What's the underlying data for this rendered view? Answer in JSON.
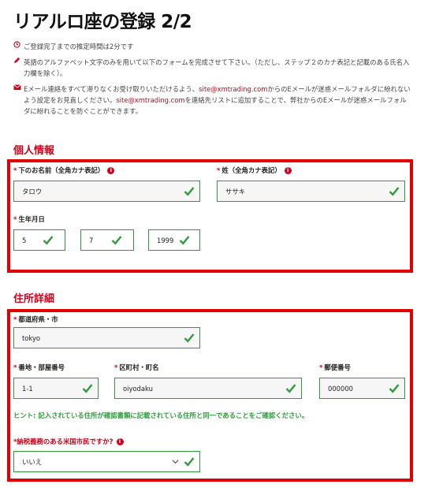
{
  "header": {
    "title": "リアルロ座の登録 2/2"
  },
  "notes": {
    "time": "ご登録完了までの推定時間は2分です",
    "alphabet": "英語のアルファベット文字のみを用いて以下のフォームを完成させて下さい。（ただし、ステップ２のカナ表記と記載のある氏名入力欄を除く）。",
    "email_a": "Eメール連絡をすべて滞りなくお受け取りいただけるよう、",
    "email_addr_1": "site@xmtrading.com",
    "email_b": "からのEメールが迷惑メールフォルダに紛れないよう設定をお見直しください。",
    "email_addr_2": "site@xmtrading.com",
    "email_c": "を連絡先リストに追加することで、弊社からのEメールが迷惑メールフォルダに紛れることを防ぐことができます。"
  },
  "personal": {
    "section_title": "個人情報",
    "first_name_label": "下のお名前（全角カナ表記）",
    "first_name_value": "タロウ",
    "last_name_label": "姓（全角カナ表記）",
    "last_name_value": "ササキ",
    "dob_label": "生年月日",
    "dob_day": "5",
    "dob_month": "7",
    "dob_year": "1999"
  },
  "address": {
    "section_title": "住所詳細",
    "prefecture_label": "都道府県・市",
    "prefecture_value": "tokyo",
    "street_label": "番地・部屋番号",
    "street_value": "1-1",
    "district_label": "区町村・町名",
    "district_value": "oiyodaku",
    "postal_label": "郵便番号",
    "postal_value": "000000",
    "hint": "ヒント: 記入されている住所が確認書類に記載されている住所と同一であることをご確認ください。",
    "tax_label": "*納税義務のある米国市民ですか?",
    "tax_value": "いいえ"
  },
  "colors": {
    "accent_red": "#d0021b",
    "highlight_red": "#e20000",
    "valid_green": "#2e9c3a"
  },
  "icons": {
    "clock": "clock-icon",
    "pencil": "pencil-icon",
    "mail": "mail-icon",
    "info": "info-icon",
    "check": "check-icon",
    "chevron": "chevron-down-icon"
  }
}
